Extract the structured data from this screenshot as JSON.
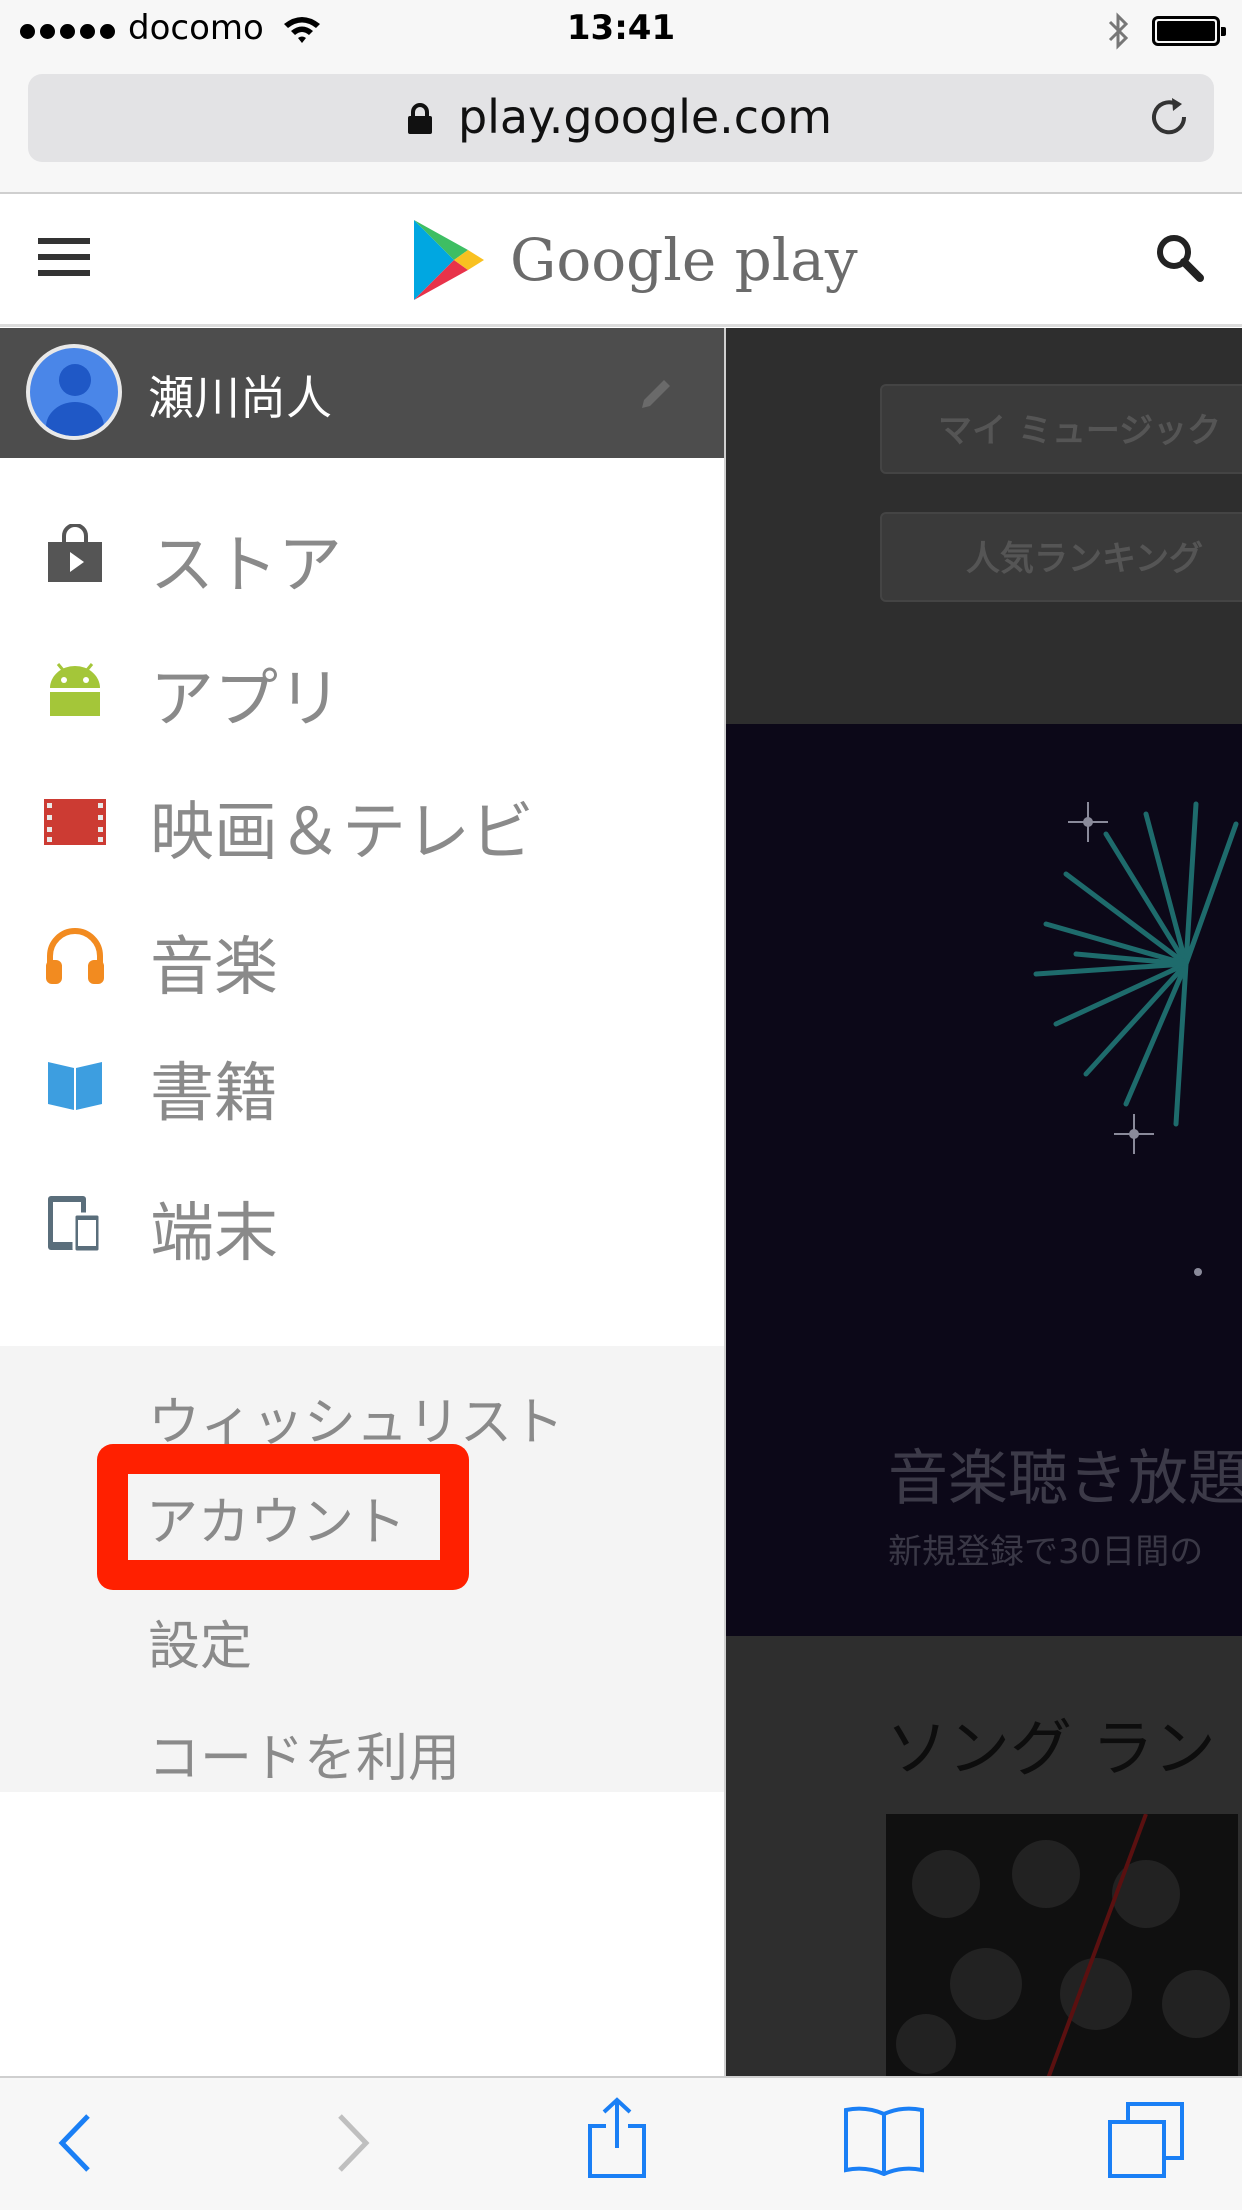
{
  "status_bar": {
    "carrier": "docomo",
    "time": "13:41"
  },
  "browser": {
    "url": "play.google.com"
  },
  "header": {
    "brand": "Google play"
  },
  "drawer": {
    "user_name": "瀬川尚人",
    "nav_items": [
      {
        "label": "ストア",
        "icon": "store-bag-icon",
        "color": "#555555"
      },
      {
        "label": "アプリ",
        "icon": "android-icon",
        "color": "#a4c639"
      },
      {
        "label": "映画＆テレビ",
        "icon": "film-icon",
        "color": "#cc3b33"
      },
      {
        "label": "音楽",
        "icon": "headphones-icon",
        "color": "#f28b20"
      },
      {
        "label": "書籍",
        "icon": "book-icon",
        "color": "#3d9ee0"
      },
      {
        "label": "端末",
        "icon": "devices-icon",
        "color": "#5a6e7b"
      }
    ],
    "sub_items": [
      "ウィッシュリスト",
      "アカウント",
      "設定",
      "コードを利用"
    ],
    "highlighted_item": "アカウント",
    "highlight_color": "#ff2000"
  },
  "page": {
    "chips": [
      "マイ ミュージック",
      "人気ランキング"
    ],
    "banner_title": "音楽聴き放題",
    "banner_subtitle": "新規登録で30日間の",
    "section_title": "ソング ラン"
  },
  "toolbar": {
    "accent": "#1a7ff5"
  }
}
